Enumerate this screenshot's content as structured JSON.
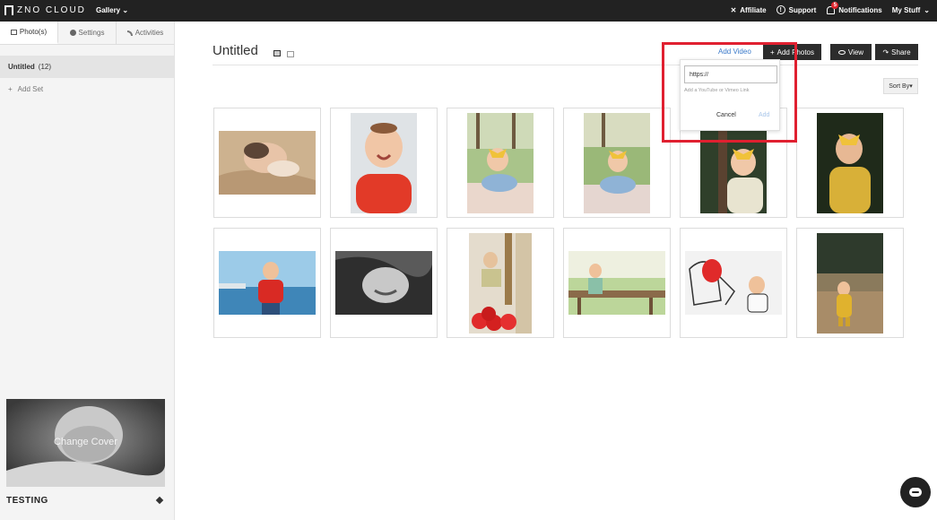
{
  "topbar": {
    "brand": "ZNO CLOUD",
    "gallery_menu": "Gallery",
    "links": {
      "affiliate": "Affiliate",
      "support": "Support",
      "notifications": "Notifications",
      "notifications_count": "5",
      "my_stuff": "My Stuff"
    }
  },
  "sidebar": {
    "tabs": [
      "Photo(s)",
      "Settings",
      "Activities"
    ],
    "active_tab": "Photo(s)",
    "set": {
      "name": "Untitled",
      "count": "(12)"
    },
    "add_set": "Add Set",
    "cover_overlay": "Change Cover",
    "collection_name": "TESTING"
  },
  "main": {
    "album_title": "Untitled",
    "add_video": "Add Video",
    "add_photos": "Add Photos",
    "view": "View",
    "share": "Share",
    "sort_by": "Sort By"
  },
  "add_video_popover": {
    "url_value": "https://",
    "hint": "Add a YouTube or Vimeo Link",
    "cancel": "Cancel",
    "add": "Add"
  },
  "photos": [
    {
      "subject": "sleeping newborn on blanket",
      "orientation": "landscape"
    },
    {
      "subject": "smiling baby in red shirt",
      "orientation": "portrait"
    },
    {
      "subject": "baby with yellow bow lying on blanket outdoors",
      "orientation": "portrait"
    },
    {
      "subject": "baby with yellow bow lying on blanket on grass",
      "orientation": "portrait"
    },
    {
      "subject": "toddler with yellow bow near tree",
      "orientation": "portrait"
    },
    {
      "subject": "toddler with yellow bow sitting",
      "orientation": "portrait"
    },
    {
      "subject": "child in red shirt by lake",
      "orientation": "landscape"
    },
    {
      "subject": "black and white smiling baby",
      "orientation": "landscape"
    },
    {
      "subject": "child by window with red balloons",
      "orientation": "portrait"
    },
    {
      "subject": "toddler at wooden bench",
      "orientation": "landscape"
    },
    {
      "subject": "baby with red balloon and drawing",
      "orientation": "landscape"
    },
    {
      "subject": "toddler in yellow coat in field",
      "orientation": "portrait"
    }
  ],
  "colors": {
    "topbar": "#222222",
    "highlight": "#e02030",
    "link": "#3a79c9"
  }
}
